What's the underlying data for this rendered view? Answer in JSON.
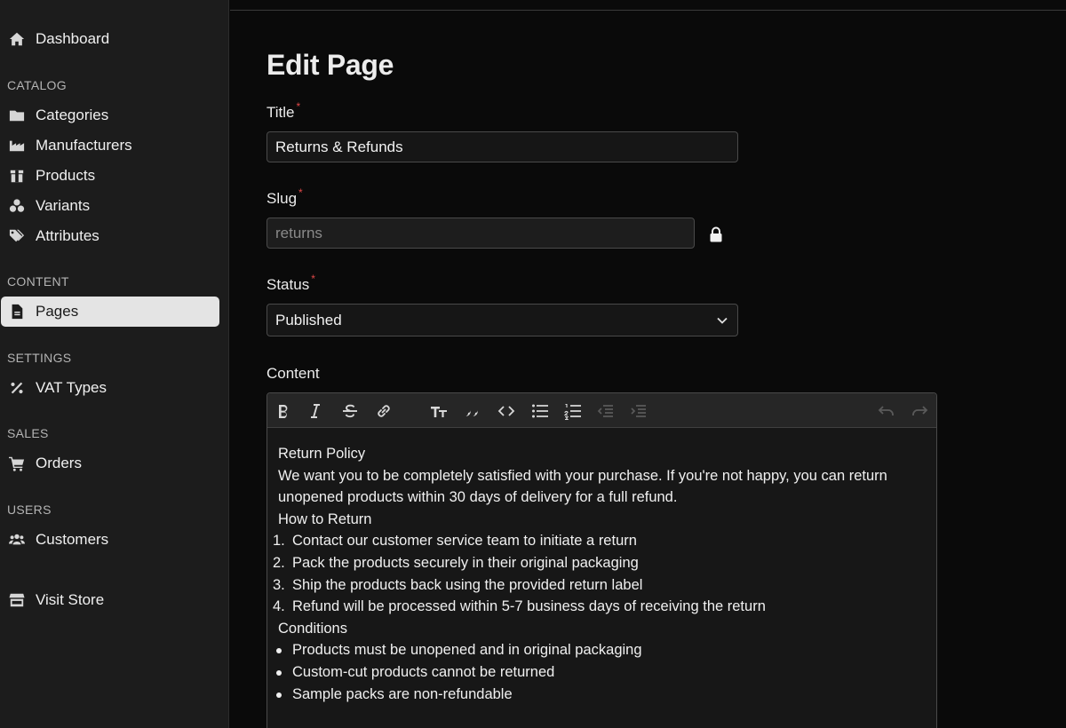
{
  "sidebar": {
    "dashboard": "Dashboard",
    "sections": {
      "catalog": "CATALOG",
      "content": "CONTENT",
      "settings": "SETTINGS",
      "sales": "SALES",
      "users": "USERS"
    },
    "items": {
      "categories": "Categories",
      "manufacturers": "Manufacturers",
      "products": "Products",
      "variants": "Variants",
      "attributes": "Attributes",
      "pages": "Pages",
      "vat_types": "VAT Types",
      "orders": "Orders",
      "customers": "Customers",
      "visit_store": "Visit Store"
    },
    "active": "pages"
  },
  "page": {
    "title": "Edit Page"
  },
  "form": {
    "title_label": "Title",
    "title_value": "Returns & Refunds",
    "slug_label": "Slug",
    "slug_value": "returns",
    "status_label": "Status",
    "status_value": "Published",
    "content_label": "Content",
    "required_mark": "*"
  },
  "editor": {
    "content": {
      "heading1": "Return Policy",
      "intro": "We want you to be completely satisfied with your purchase. If you're not happy, you can return unopened products within 30 days of delivery for a full refund.",
      "heading2": "How to Return",
      "steps": [
        {
          "num": "1.",
          "text": "Contact our customer service team to initiate a return"
        },
        {
          "num": "2.",
          "text": "Pack the products securely in their original packaging"
        },
        {
          "num": "3.",
          "text": "Ship the products back using the provided return label"
        },
        {
          "num": "4.",
          "text": "Refund will be processed within 5-7 business days of receiving the return"
        }
      ],
      "heading3": "Conditions",
      "conditions": [
        "Products must be unopened and in original packaging",
        "Custom-cut products cannot be returned",
        "Sample packs are non-refundable"
      ]
    }
  },
  "colors": {
    "background": "#0a0a0a",
    "sidebar": "#1c1c1c",
    "active_item": "#e4e4e4",
    "required": "#e04848"
  }
}
